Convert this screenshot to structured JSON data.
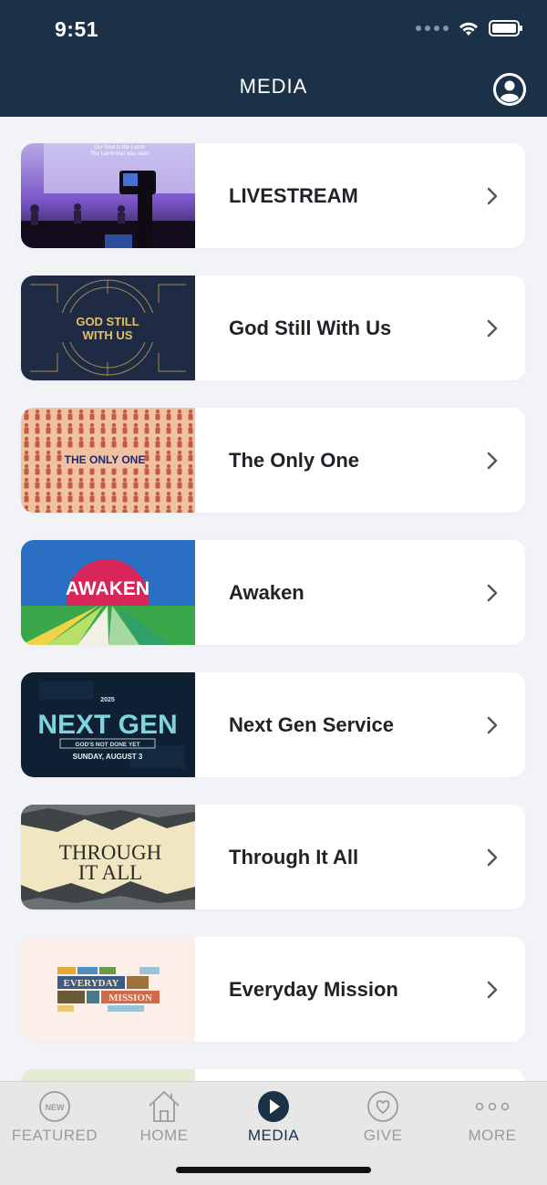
{
  "status_bar": {
    "time": "9:51"
  },
  "header": {
    "title": "MEDIA"
  },
  "media_items": [
    {
      "label": "LIVESTREAM",
      "thumb_lyrics_1": "Our God is the Lamb",
      "thumb_lyrics_2": "The Lamb that was slain"
    },
    {
      "label": "God Still With Us",
      "thumb_line_1": "GOD STILL",
      "thumb_line_2": "WITH US"
    },
    {
      "label": "The Only One",
      "thumb_text": "THE ONLY ONE"
    },
    {
      "label": "Awaken",
      "thumb_text": "AWAKEN"
    },
    {
      "label": "Next Gen Service",
      "thumb_year": "2025",
      "thumb_title": "NEXT GEN",
      "thumb_sub": "GOD'S NOT DONE YET",
      "thumb_date": "SUNDAY, AUGUST 3"
    },
    {
      "label": "Through It All",
      "thumb_line_1": "THROUGH",
      "thumb_line_2": "IT ALL"
    },
    {
      "label": "Everyday Mission",
      "thumb_line_1": "EVERYDAY",
      "thumb_line_2": "MISSION"
    }
  ],
  "tab_bar": {
    "tabs": [
      {
        "label": "FEATURED",
        "badge": "NEW",
        "icon": "new-badge-icon"
      },
      {
        "label": "HOME",
        "icon": "home-icon"
      },
      {
        "label": "MEDIA",
        "icon": "play-icon",
        "active": true
      },
      {
        "label": "GIVE",
        "icon": "heart-icon"
      },
      {
        "label": "MORE",
        "icon": "more-dots-icon"
      }
    ]
  },
  "colors": {
    "header_bg": "#1b3148",
    "active_tab": "#1b3148",
    "inactive_tab": "#9b9b9b"
  }
}
